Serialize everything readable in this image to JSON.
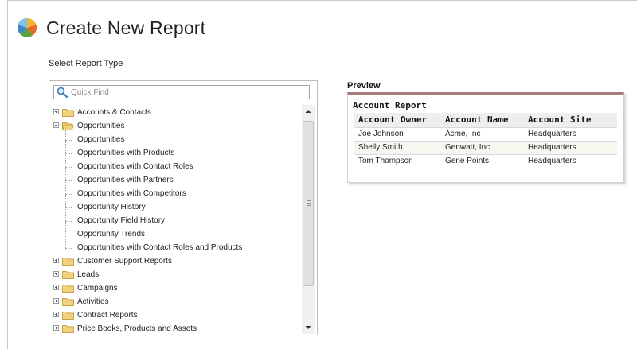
{
  "page": {
    "title": "Create New Report",
    "subtitle": "Select Report Type"
  },
  "search": {
    "placeholder": "Quick Find"
  },
  "tree": {
    "folders_before": [
      {
        "label": "Accounts & Contacts",
        "expanded": false
      }
    ],
    "open_folder": {
      "label": "Opportunities",
      "expanded": true,
      "children": [
        "Opportunities",
        "Opportunities with Products",
        "Opportunities with Contact Roles",
        "Opportunities with Partners",
        "Opportunities with Competitors",
        "Opportunity History",
        "Opportunity Field History",
        "Opportunity Trends",
        "Opportunities with Contact Roles and Products"
      ]
    },
    "folders_after": [
      {
        "label": "Customer Support Reports",
        "expanded": false
      },
      {
        "label": "Leads",
        "expanded": false
      },
      {
        "label": "Campaigns",
        "expanded": false
      },
      {
        "label": "Activities",
        "expanded": false
      },
      {
        "label": "Contract Reports",
        "expanded": false
      },
      {
        "label": "Price Books, Products and Assets",
        "expanded": false
      }
    ]
  },
  "preview": {
    "label": "Preview",
    "report_title": "Account Report",
    "columns": [
      "Account Owner",
      "Account Name",
      "Account Site"
    ],
    "rows": [
      [
        "Joe Johnson",
        "Acme, Inc",
        "Headquarters"
      ],
      [
        "Shelly Smith",
        "Genwatt, Inc",
        "Headquarters"
      ],
      [
        "Tom Thompson",
        "Gene Points",
        "Headquarters"
      ]
    ]
  },
  "icons": {
    "logo": "report-logo-icon",
    "search": "magnifier-icon",
    "folder": "folder-icon"
  },
  "colors": {
    "folder": "#f2d27a",
    "preview_accent": "#a57e78",
    "alt_row": "#f7f6ef"
  }
}
